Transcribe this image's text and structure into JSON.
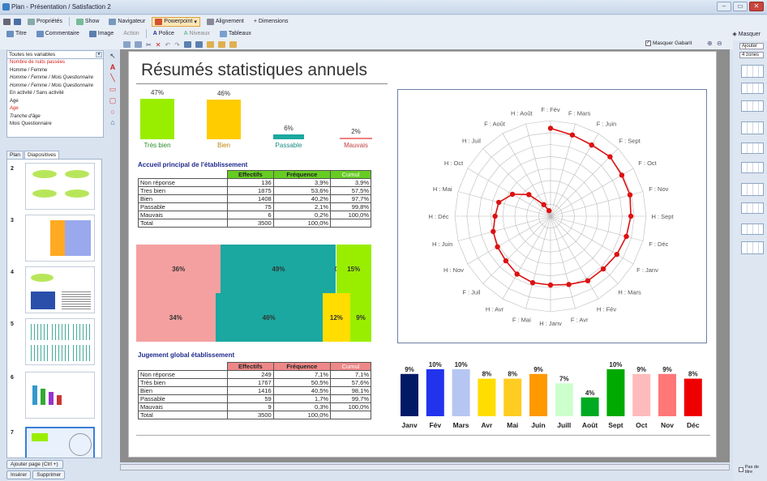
{
  "window": {
    "title": "Plan - Présentation / Satisfaction 2"
  },
  "toolbar1": {
    "properties": "Propriétés",
    "show": "Show",
    "navigator": "Navigateur",
    "powerpoint": "Powerpoint",
    "alignment": "Alignement",
    "dimensions": "+ Dimensions"
  },
  "toolbar2": {
    "title": "Titre",
    "comment": "Commentaire",
    "image": "Image",
    "action": "Action",
    "font": "Police",
    "levels": "Niveaux",
    "tables": "Tableaux",
    "hide": "Masquer"
  },
  "toolbar3": {
    "hide_template": "Masquer Gabarit",
    "add": "Ajouter",
    "zones": "4 zones"
  },
  "left": {
    "selector": "Toutes les variables",
    "vars": [
      {
        "label": "Nombre de nuits passées",
        "style": "red"
      },
      {
        "label": "Homme / Femme",
        "style": ""
      },
      {
        "label": "Homme / Femme / Mois Questionnaire",
        "style": "it"
      },
      {
        "label": "Homme / Femme / Mois Questionnaire",
        "style": "it"
      },
      {
        "label": "En activité / Sans activité",
        "style": ""
      },
      {
        "label": "Age",
        "style": ""
      },
      {
        "label": "Age",
        "style": "red it"
      },
      {
        "label": "Tranche d'âge",
        "style": "it"
      },
      {
        "label": "Mois Questionnaire",
        "style": ""
      }
    ],
    "tab_plan": "Plan",
    "tab_slides": "Diapositives",
    "slide_numbers": [
      "2",
      "3",
      "4",
      "5",
      "6",
      "7"
    ],
    "add_page": "Ajouter page (Ctrl +)",
    "insert": "Insérer",
    "delete": "Supprimer"
  },
  "bottom": {
    "no_title": "Pas de titre"
  },
  "slide": {
    "title": "Résumés statistiques annuels",
    "mini_bars": [
      {
        "label": "Très bien",
        "pct": "47%",
        "value": 47,
        "color": "#99ee00"
      },
      {
        "label": "Bien",
        "pct": "46%",
        "value": 46,
        "color": "#ffcc00"
      },
      {
        "label": "Passable",
        "pct": "6%",
        "value": 6,
        "color": "#1aa8a0"
      },
      {
        "label": "Mauvais",
        "pct": "2%",
        "value": 2,
        "color": "#f08080"
      }
    ],
    "table1": {
      "title": "Accueil principal de l'établissement",
      "headers": [
        "",
        "Effectifs",
        "Fréquence",
        "Cumul"
      ],
      "rows": [
        [
          "Non réponse",
          "136",
          "3,9%",
          "3,9%"
        ],
        [
          "Tres bien",
          "1875",
          "53,6%",
          "57,5%"
        ],
        [
          "Bien",
          "1408",
          "40,2%",
          "97,7%"
        ],
        [
          "Passable",
          "75",
          "2,1%",
          "99,8%"
        ],
        [
          "Mauvais",
          "6",
          "0,2%",
          "100,0%"
        ],
        [
          "Total",
          "3500",
          "100,0%",
          ""
        ]
      ]
    },
    "table2": {
      "title": "Jugement global établissement",
      "headers": [
        "",
        "Effectifs",
        "Fréquence",
        "Cumul"
      ],
      "rows": [
        [
          "Non réponse",
          "249",
          "7,1%",
          "7,1%"
        ],
        [
          "Très bien",
          "1767",
          "50,5%",
          "57,6%"
        ],
        [
          "Bien",
          "1416",
          "40,5%",
          "98,1%"
        ],
        [
          "Passable",
          "59",
          "1,7%",
          "99,7%"
        ],
        [
          "Mauvais",
          "9",
          "0,3%",
          "100,0%"
        ],
        [
          "Total",
          "3500",
          "100,0%",
          ""
        ]
      ]
    },
    "stacked": {
      "rows": [
        {
          "segments": [
            {
              "value": 36,
              "label": "36%",
              "color": "#f4a0a0"
            },
            {
              "value": 49,
              "label": "49%",
              "color": "#1aa8a0"
            },
            {
              "value": 0,
              "label": "0%",
              "color": "#ffdd00"
            },
            {
              "value": 15,
              "label": "15%",
              "color": "#99ee00"
            }
          ]
        },
        {
          "segments": [
            {
              "value": 34,
              "label": "34%",
              "color": "#f4a0a0"
            },
            {
              "value": 46,
              "label": "46%",
              "color": "#1aa8a0"
            },
            {
              "value": 12,
              "label": "12%",
              "color": "#ffdd00"
            },
            {
              "value": 9,
              "label": "9%",
              "color": "#99ee00"
            }
          ]
        }
      ]
    }
  },
  "chart_data": [
    {
      "type": "radar",
      "categories": [
        "F : Fév",
        "F : Mars",
        "F : Juin",
        "F : Sept",
        "F : Oct",
        "F : Nov",
        "H : Sept",
        "F : Déc",
        "F : Janv",
        "H : Mars",
        "H : Fév",
        "F : Avr",
        "H : Janv",
        "F : Mai",
        "H : Avr",
        "F : Juil",
        "H : Nov",
        "H : Juin",
        "H : Déc",
        "H : Mai",
        "H : Oct",
        "H : Juil",
        "F : Août",
        "H : Août"
      ],
      "values": [
        0.92,
        0.88,
        0.86,
        0.88,
        0.86,
        0.86,
        0.84,
        0.82,
        0.8,
        0.78,
        0.78,
        0.74,
        0.72,
        0.72,
        0.7,
        0.66,
        0.64,
        0.62,
        0.58,
        0.56,
        0.46,
        0.32,
        0.14,
        0.06
      ]
    },
    {
      "type": "bar",
      "categories": [
        "Janv",
        "Fév",
        "Mars",
        "Avr",
        "Mai",
        "Juin",
        "Juill",
        "Août",
        "Sept",
        "Oct",
        "Nov",
        "Déc"
      ],
      "values": [
        9,
        10,
        10,
        8,
        8,
        9,
        7,
        4,
        10,
        9,
        9,
        8
      ],
      "labels": [
        "9%",
        "10%",
        "10%",
        "8%",
        "8%",
        "9%",
        "7%",
        "4%",
        "10%",
        "9%",
        "9%",
        "8%"
      ],
      "colors": [
        "#001a66",
        "#2233ee",
        "#b6c6f2",
        "#ffdd00",
        "#ffcc22",
        "#ff9900",
        "#ccffcc",
        "#00aa22",
        "#00aa00",
        "#ffbbbb",
        "#ff7777",
        "#ee0000"
      ],
      "ylim": [
        0,
        10
      ]
    }
  ]
}
